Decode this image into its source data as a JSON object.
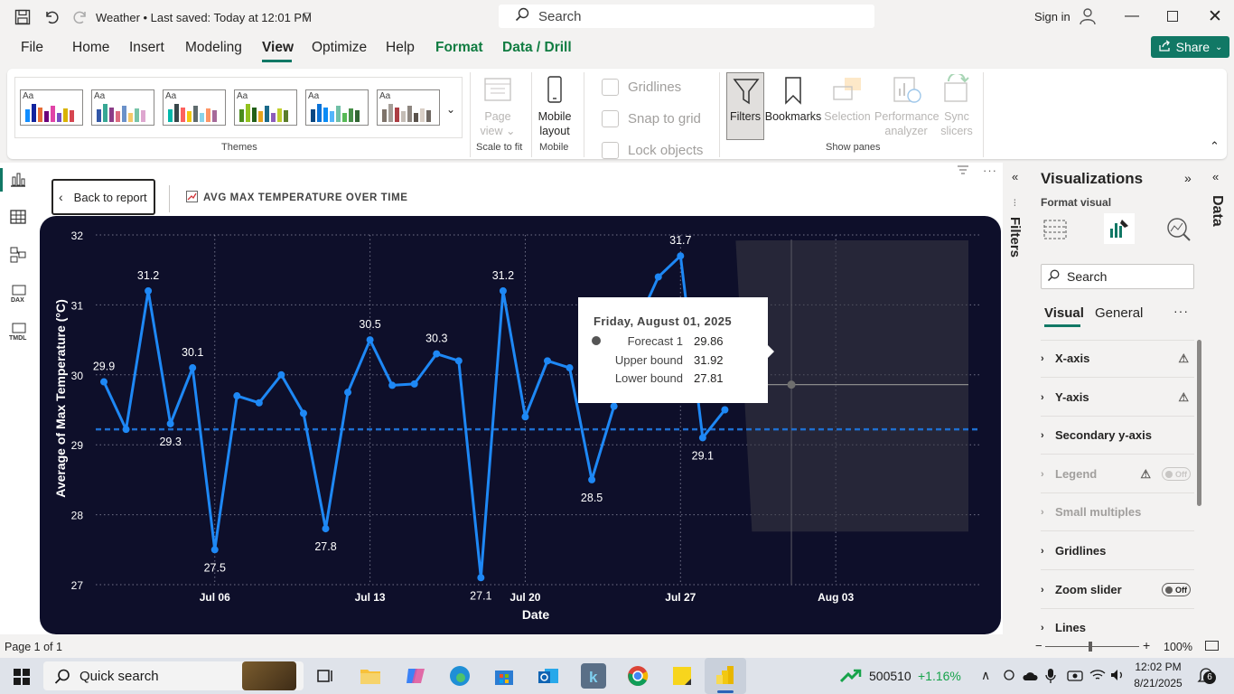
{
  "window": {
    "title": "Weather • Last saved: Today at 12:01 PM",
    "search_placeholder": "Search",
    "sign_in": "Sign in"
  },
  "menu": {
    "items": [
      "File",
      "Home",
      "Insert",
      "Modeling",
      "View",
      "Optimize",
      "Help",
      "Format",
      "Data / Drill"
    ],
    "active": "View",
    "share": "Share"
  },
  "ribbon": {
    "themes_label": "Themes",
    "theme_aa": "Aa",
    "page_view": "Page view",
    "scale_to_fit": "Scale to fit",
    "mobile_layout": "Mobile layout",
    "mobile": "Mobile",
    "gridlines": "Gridlines",
    "snap_to_grid": "Snap to grid",
    "lock_objects": "Lock objects",
    "filters": "Filters",
    "bookmarks": "Bookmarks",
    "selection": "Selection",
    "performance_analyzer": "Performance analyzer",
    "sync_slicers": "Sync slicers",
    "show_panes": "Show panes"
  },
  "report": {
    "back_to_report": "Back to report",
    "visual_title": "AVG MAX TEMPERATURE OVER TIME"
  },
  "tooltip": {
    "date": "Friday, August 01, 2025",
    "rows": [
      {
        "label": "Forecast 1",
        "value": "29.86"
      },
      {
        "label": "Upper bound",
        "value": "31.92"
      },
      {
        "label": "Lower bound",
        "value": "27.81"
      }
    ]
  },
  "chart_data": {
    "type": "line",
    "xlabel": "Date",
    "ylabel": "Average of Max Temperature (°C)",
    "ylim": [
      27,
      32
    ],
    "y_ticks": [
      27,
      28,
      29,
      30,
      31,
      32
    ],
    "x_ticks": [
      "Jul 06",
      "Jul 13",
      "Jul 20",
      "Jul 27",
      "Aug 03"
    ],
    "average_line": 29.22,
    "line_color": "#1e88f5",
    "series": [
      {
        "values": [
          29.9,
          29.22,
          31.2,
          29.3,
          30.1,
          27.5,
          29.7,
          29.6,
          30.0,
          29.45,
          27.8,
          29.75,
          30.5,
          29.85,
          29.87,
          30.3,
          30.2,
          27.1,
          31.2,
          29.4,
          30.2,
          30.1,
          28.5,
          29.55,
          30.7,
          31.4,
          31.7,
          29.1,
          29.5
        ],
        "start_date": "Jul 01",
        "data_labels": {
          "0": "29.9",
          "2": "31.2",
          "3": "29.3",
          "4": "30.1",
          "5": "27.5",
          "10": "27.8",
          "12": "30.5",
          "15": "30.3",
          "17": "27.1",
          "18": "31.2",
          "22": "28.5",
          "26": "31.7",
          "27": "29.1"
        }
      }
    ],
    "forecast": {
      "date": "Aug 01",
      "value": 29.86,
      "upper": 31.92,
      "lower": 27.81
    }
  },
  "visualizations": {
    "title": "Visualizations",
    "subtitle": "Format visual",
    "search_placeholder": "Search",
    "tabs": [
      "Visual",
      "General"
    ],
    "sections": [
      {
        "label": "X-axis",
        "warn": true,
        "disabled": false,
        "toggle": ""
      },
      {
        "label": "Y-axis",
        "warn": true,
        "disabled": false,
        "toggle": ""
      },
      {
        "label": "Secondary y-axis",
        "warn": false,
        "disabled": false,
        "toggle": ""
      },
      {
        "label": "Legend",
        "warn": true,
        "disabled": true,
        "toggle": "Off"
      },
      {
        "label": "Small multiples",
        "warn": false,
        "disabled": true,
        "toggle": ""
      },
      {
        "label": "Gridlines",
        "warn": false,
        "disabled": false,
        "toggle": ""
      },
      {
        "label": "Zoom slider",
        "warn": false,
        "disabled": false,
        "toggle": "Off"
      },
      {
        "label": "Lines",
        "warn": false,
        "disabled": false,
        "toggle": ""
      }
    ]
  },
  "side_labels": {
    "filters": "Filters",
    "data": "Data"
  },
  "status": {
    "page": "Page 1 of 1",
    "zoom": "100%"
  },
  "taskbar": {
    "quick_search": "Quick search",
    "stock_value": "500510",
    "stock_change": "+1.16%",
    "time": "12:02 PM",
    "date": "8/21/2025",
    "notifications": "6"
  }
}
